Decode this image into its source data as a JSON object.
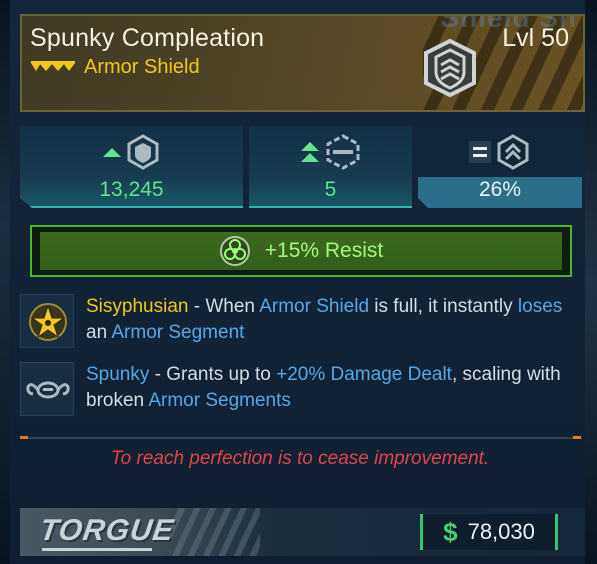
{
  "item": {
    "name": "Spunky Compleation",
    "level": "Lvl 50",
    "type": "Armor Shield",
    "header_ghost_text": "Shield Sh",
    "rarity_icon": "rarity-chevrons-icon",
    "type_icon": "armor-shield-icon"
  },
  "stats": [
    {
      "value": "13,245",
      "indicator": "up",
      "icon": "shield-capacity-icon"
    },
    {
      "value": "5",
      "indicator": "double-up",
      "icon": "armor-segment-icon"
    },
    {
      "value": "26%",
      "indicator": "equal",
      "icon": "recharge-icon"
    }
  ],
  "resist": {
    "text": "+15% Resist",
    "icon": "radiation-icon",
    "color": "#9cff7a"
  },
  "perks": [
    {
      "icon": "sisyphusian-star-icon",
      "name": "Sisyphusian",
      "t1": " - When ",
      "h1": "Armor Shield",
      "t2": " is full, it instantly ",
      "h2": "loses",
      "t3": " an ",
      "h3": "Armor Segment"
    },
    {
      "icon": "spunky-flex-icon",
      "name": "Spunky",
      "t1": " - Grants up to ",
      "h1": "+20% Damage Dealt",
      "t2": ", scaling with broken ",
      "h2": "Armor Segments"
    }
  ],
  "flavor_text": "To reach perfection is to cease improvement.",
  "footer": {
    "manufacturer": "TORGUE",
    "currency_symbol": "$",
    "price": "78,030"
  },
  "colors": {
    "legendary_yellow": "#f0c81e",
    "keyword_blue": "#55a8e8",
    "stat_green": "#5fe38c",
    "flavor_red": "#e0444c",
    "header_bronze": "#5a4a26"
  }
}
